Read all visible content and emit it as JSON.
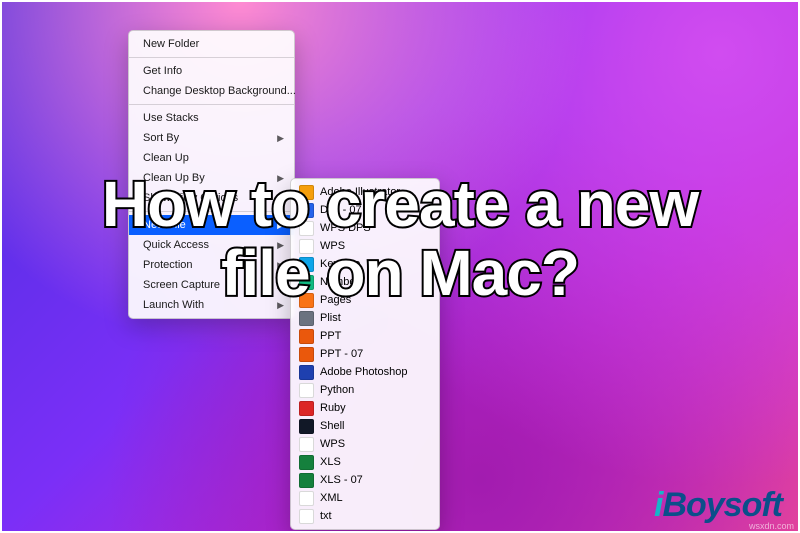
{
  "overlay": {
    "title_line1": "How to create a new",
    "title_line2": "file on Mac?"
  },
  "brand": {
    "prefix": "i",
    "rest": "Boysoft"
  },
  "site_watermark": "wsxdn.com",
  "main_menu": {
    "groups": [
      [
        {
          "label": "New Folder",
          "submenu": false,
          "selected": false
        }
      ],
      [
        {
          "label": "Get Info",
          "submenu": false,
          "selected": false
        },
        {
          "label": "Change Desktop Background...",
          "submenu": false,
          "selected": false
        }
      ],
      [
        {
          "label": "Use Stacks",
          "submenu": false,
          "selected": false
        },
        {
          "label": "Sort By",
          "submenu": true,
          "selected": false
        },
        {
          "label": "Clean Up",
          "submenu": false,
          "selected": false
        },
        {
          "label": "Clean Up By",
          "submenu": true,
          "selected": false
        },
        {
          "label": "Show View Options",
          "submenu": false,
          "selected": false
        }
      ],
      [
        {
          "label": "New File",
          "submenu": true,
          "selected": true
        },
        {
          "label": "Quick Access",
          "submenu": true,
          "selected": false
        },
        {
          "label": "Protection",
          "submenu": true,
          "selected": false
        },
        {
          "label": "Screen Capture",
          "submenu": true,
          "selected": false
        },
        {
          "label": "Launch With",
          "submenu": true,
          "selected": false
        }
      ]
    ]
  },
  "submenu": {
    "items": [
      {
        "label": "Adobe Illustrator",
        "iconColor": "#f59e0b"
      },
      {
        "label": "Doc - 07",
        "iconColor": "#2563eb"
      },
      {
        "label": "WPS DPS",
        "iconColor": "#ffffff"
      },
      {
        "label": "WPS",
        "iconColor": "#ffffff"
      },
      {
        "label": "Keynote",
        "iconColor": "#0ea5e9"
      },
      {
        "label": "Numbers",
        "iconColor": "#10b981"
      },
      {
        "label": "Pages",
        "iconColor": "#f97316"
      },
      {
        "label": "Plist",
        "iconColor": "#6b7280"
      },
      {
        "label": "PPT",
        "iconColor": "#ea580c"
      },
      {
        "label": "PPT - 07",
        "iconColor": "#ea580c"
      },
      {
        "label": "Adobe Photoshop",
        "iconColor": "#1e40af"
      },
      {
        "label": "Python",
        "iconColor": "#ffffff"
      },
      {
        "label": "Ruby",
        "iconColor": "#dc2626"
      },
      {
        "label": "Shell",
        "iconColor": "#111827"
      },
      {
        "label": "WPS",
        "iconColor": "#ffffff"
      },
      {
        "label": "XLS",
        "iconColor": "#15803d"
      },
      {
        "label": "XLS - 07",
        "iconColor": "#15803d"
      },
      {
        "label": "XML",
        "iconColor": "#ffffff"
      },
      {
        "label": "txt",
        "iconColor": "#ffffff"
      }
    ]
  }
}
